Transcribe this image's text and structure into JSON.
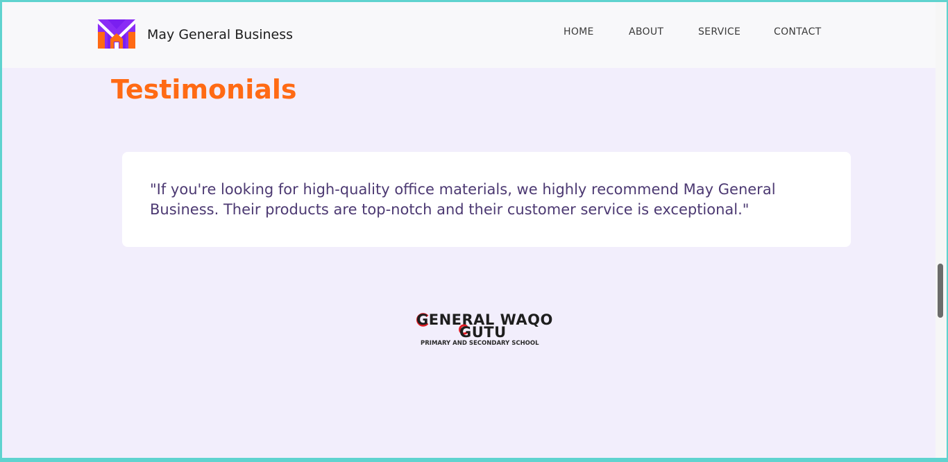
{
  "header": {
    "brand_name": "May General Business",
    "logo_icon": "mg-logo-icon",
    "nav": [
      {
        "label": "HOME"
      },
      {
        "label": "ABOUT"
      },
      {
        "label": "SERVICE"
      },
      {
        "label": "CONTACT"
      }
    ]
  },
  "testimonials": {
    "title": "Testimonials",
    "quote": "\"If you're looking for high-quality office materials, we highly recommend May General Business. Their products are top-notch and their customer service is exceptional.\""
  },
  "partner": {
    "line1": "GENERAL WAQO",
    "line2": "GUTU",
    "line3": "PRIMARY AND SECONDARY SCHOOL"
  },
  "colors": {
    "accent_orange": "#ff6a14",
    "quote_text": "#4c3972",
    "page_background": "#f2eefc",
    "logo_purple": "#7a1ff0"
  }
}
